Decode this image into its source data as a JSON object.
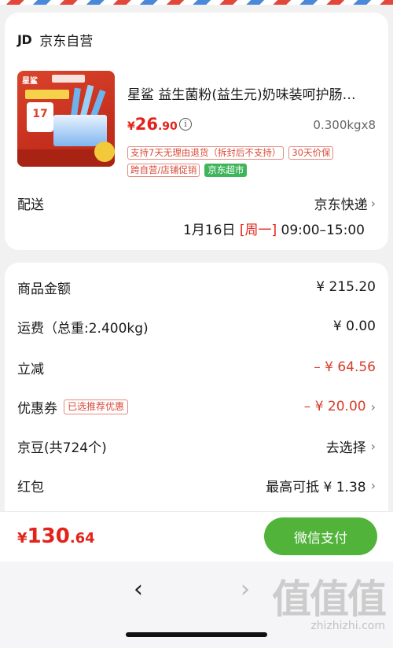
{
  "store": {
    "logo": "JD",
    "name": "京东自营"
  },
  "product": {
    "title": "星鲨 益生菌粉(益生元)奶味装呵护肠…",
    "price_symbol": "¥",
    "price_int": "26",
    "price_dec": ".90",
    "qty": "0.300kgx8",
    "tags_line1": [
      "支持7天无理由退货（拆封后不支持）",
      "30天价保"
    ],
    "tags_line2": [
      "跨自营/店铺促销",
      "京东超市"
    ]
  },
  "delivery": {
    "label": "配送",
    "method": "京东快递",
    "date": "1月16日",
    "weekday_open": "[",
    "weekday": "周一",
    "weekday_close": "]",
    "time": "09:00–15:00"
  },
  "summary": {
    "goods_label": "商品金额",
    "goods_value": "¥ 215.20",
    "shipping_label": "运费（总重:2.400kg)",
    "shipping_value": "¥ 0.00",
    "discount_label": "立减",
    "discount_value": "– ¥ 64.56",
    "coupon_label": "优惠券",
    "coupon_tag": "已选推荐优惠",
    "coupon_value": "– ¥ 20.00",
    "beans_label": "京豆(共724个)",
    "beans_value": "去选择",
    "redpacket_label": "红包",
    "redpacket_value": "最高可抵 ¥ 1.38"
  },
  "pay": {
    "total_symbol": "¥",
    "total_int": "130",
    "total_dec": ".64",
    "button": "微信支付",
    "button_color": "#52b33a"
  },
  "nav": {
    "back": "‹",
    "forward": "›"
  },
  "watermark": {
    "logo": "值值值",
    "url": "zhizhizhi.com"
  },
  "colors": {
    "price_red": "#e2231a",
    "tag_red": "#d94a3a",
    "market_green": "#3fb55b"
  }
}
